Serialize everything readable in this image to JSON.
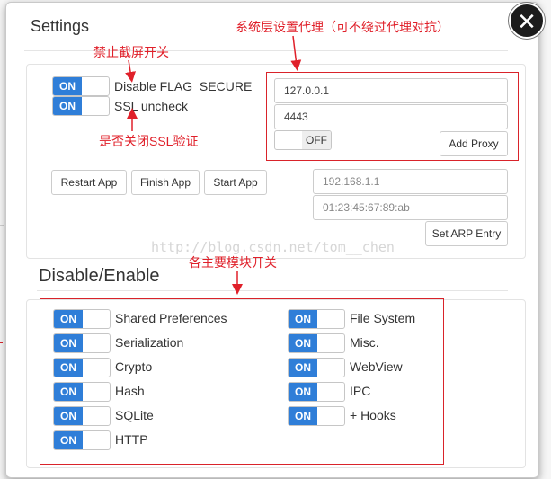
{
  "dialog": {
    "title": "Settings",
    "close_glyph": "✕"
  },
  "security_toggles": [
    {
      "state": "ON",
      "label": "Disable FLAG_SECURE"
    },
    {
      "state": "ON",
      "label": "SSL uncheck"
    }
  ],
  "proxy": {
    "host": "127.0.0.1",
    "port": "4443",
    "toggle_state": "OFF",
    "add_button": "Add Proxy"
  },
  "app_buttons": {
    "restart": "Restart App",
    "finish": "Finish App",
    "start": "Start App"
  },
  "arp": {
    "ip_placeholder": "192.168.1.1",
    "mac_placeholder": "01:23:45:67:89:ab",
    "button": "Set ARP Entry"
  },
  "modules": {
    "title": "Disable/Enable",
    "left": [
      {
        "state": "ON",
        "label": "Shared Preferences"
      },
      {
        "state": "ON",
        "label": "Serialization"
      },
      {
        "state": "ON",
        "label": "Crypto"
      },
      {
        "state": "ON",
        "label": "Hash"
      },
      {
        "state": "ON",
        "label": "SQLite"
      },
      {
        "state": "ON",
        "label": "HTTP"
      }
    ],
    "right": [
      {
        "state": "ON",
        "label": "File System"
      },
      {
        "state": "ON",
        "label": "Misc."
      },
      {
        "state": "ON",
        "label": "WebView"
      },
      {
        "state": "ON",
        "label": "IPC"
      },
      {
        "state": "ON",
        "label": "+ Hooks"
      }
    ]
  },
  "annotations": {
    "flag_secure": "禁止截屏开关",
    "ssl": "是否关闭SSL验证",
    "proxy": "系统层设置代理（可不绕过代理对抗）",
    "modules": "各主要模块开关"
  },
  "watermark": "http://blog.csdn.net/tom__chen",
  "colors": {
    "toggle_on": "#2f7ed8",
    "annotation": "#e0202a"
  }
}
